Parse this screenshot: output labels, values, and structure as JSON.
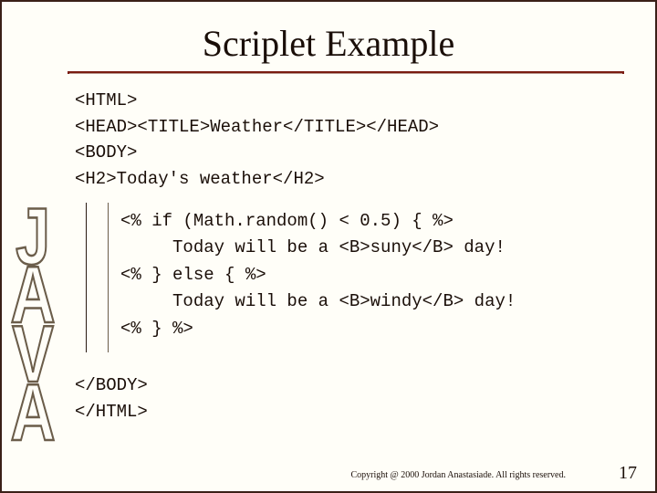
{
  "decor": {
    "java_letters": [
      "J",
      "A",
      "V",
      "A"
    ]
  },
  "title": "Scriplet Example",
  "code": {
    "head": "<HTML>\n<HEAD><TITLE>Weather</TITLE></HEAD>\n<BODY>\n<H2>Today's weather</H2>",
    "scriptlet": "<% if (Math.random() < 0.5) { %>\n     Today will be a <B>suny</B> day!\n<% } else { %>\n     Today will be a <B>windy</B> day!\n<% } %>",
    "tail": "</BODY>\n</HTML>"
  },
  "footer": {
    "copyright": "Copyright @ 2000 Jordan Anastasiade. All rights reserved.",
    "page": "17"
  }
}
